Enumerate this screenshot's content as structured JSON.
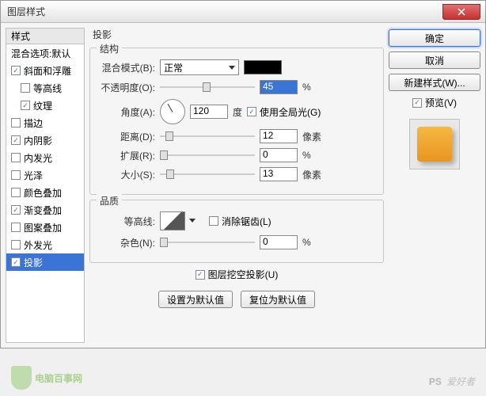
{
  "title": "图层样式",
  "left": {
    "header": "样式",
    "blend_default": "混合选项:默认",
    "items": [
      {
        "label": "斜面和浮雕",
        "checked": true,
        "sub": false
      },
      {
        "label": "等高线",
        "checked": false,
        "sub": true
      },
      {
        "label": "纹理",
        "checked": true,
        "sub": true
      },
      {
        "label": "描边",
        "checked": false,
        "sub": false
      },
      {
        "label": "内阴影",
        "checked": true,
        "sub": false
      },
      {
        "label": "内发光",
        "checked": false,
        "sub": false
      },
      {
        "label": "光泽",
        "checked": false,
        "sub": false
      },
      {
        "label": "颜色叠加",
        "checked": false,
        "sub": false
      },
      {
        "label": "渐变叠加",
        "checked": true,
        "sub": false
      },
      {
        "label": "图案叠加",
        "checked": false,
        "sub": false
      },
      {
        "label": "外发光",
        "checked": false,
        "sub": false
      },
      {
        "label": "投影",
        "checked": true,
        "sub": false,
        "selected": true
      }
    ]
  },
  "section_title": "投影",
  "structure": {
    "legend": "结构",
    "blend_label": "混合模式(B):",
    "blend_value": "正常",
    "opacity_label": "不透明度(O):",
    "opacity_value": "45",
    "opacity_unit": "%",
    "angle_label": "角度(A):",
    "angle_value": "120",
    "angle_unit": "度",
    "global_light": "使用全局光(G)",
    "global_checked": true,
    "distance_label": "距离(D):",
    "distance_value": "12",
    "distance_unit": "像素",
    "spread_label": "扩展(R):",
    "spread_value": "0",
    "spread_unit": "%",
    "size_label": "大小(S):",
    "size_value": "13",
    "size_unit": "像素"
  },
  "quality": {
    "legend": "品质",
    "contour_label": "等高线:",
    "antialias": "消除锯齿(L)",
    "antialias_checked": false,
    "noise_label": "杂色(N):",
    "noise_value": "0",
    "noise_unit": "%"
  },
  "knockout": {
    "label": "图层挖空投影(U)",
    "checked": true
  },
  "buttons": {
    "set_default": "设置为默认值",
    "reset_default": "复位为默认值"
  },
  "right": {
    "ok": "确定",
    "cancel": "取消",
    "new_style": "新建样式(W)...",
    "preview": "预览(V)",
    "preview_checked": true
  },
  "watermark": {
    "left": "电脑百事网",
    "right_ps": "PS",
    "right": "爱好者"
  }
}
